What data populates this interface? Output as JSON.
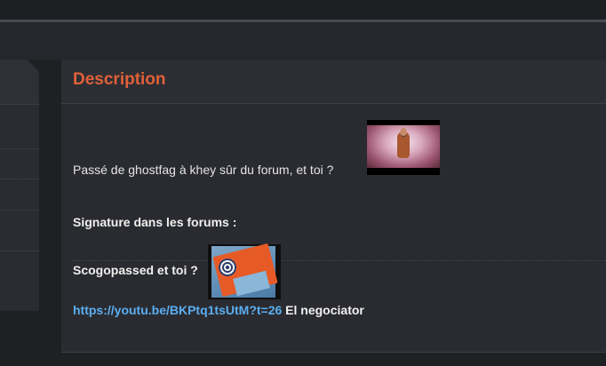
{
  "panel": {
    "title": "Description"
  },
  "description": {
    "text": "Passé de ghostfag à khey sûr du forum, et toi ?"
  },
  "signature": {
    "label": "Signature dans les forums :",
    "text": "Scogopassed et toi ?",
    "link_text": "https://youtu.be/BKPtq1tsUtM?t=26",
    "after_link": " El negociator"
  },
  "colors": {
    "accent": "#e0603a",
    "link": "#5aaef0",
    "background": "#1f2024",
    "panel": "#2a2b30"
  },
  "icons": {
    "image_1": "jesus-sticker-image",
    "image_2": "snail-book-sticker-image"
  }
}
